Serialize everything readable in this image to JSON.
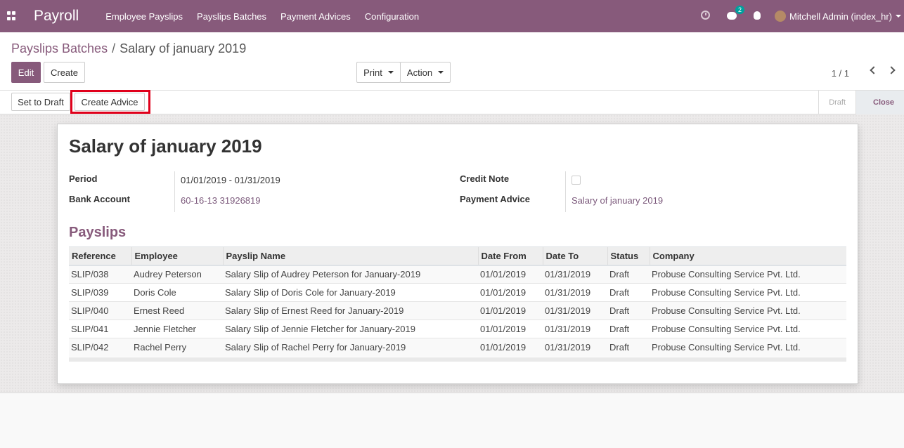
{
  "app": {
    "title": "Payroll"
  },
  "nav": {
    "menu": [
      "Employee Payslips",
      "Payslips Batches",
      "Payment Advices",
      "Configuration"
    ],
    "message_count": "2",
    "user_name": "Mitchell Admin (index_hr)"
  },
  "breadcrumb": {
    "parent": "Payslips Batches",
    "separator": "/",
    "current": "Salary of january 2019"
  },
  "buttons": {
    "edit": "Edit",
    "create": "Create",
    "print": "Print",
    "action": "Action",
    "set_to_draft": "Set to Draft",
    "create_advice": "Create Advice"
  },
  "pager": {
    "text": "1 / 1"
  },
  "status_stages": [
    "Draft",
    "Close"
  ],
  "record": {
    "title": "Salary of january 2019",
    "fields": {
      "period_label": "Period",
      "period_value": "01/01/2019 - 01/31/2019",
      "bank_label": "Bank Account",
      "bank_value": "60-16-13 31926819",
      "credit_label": "Credit Note",
      "credit_checked": false,
      "advice_label": "Payment Advice",
      "advice_value": "Salary of january 2019"
    }
  },
  "payslips": {
    "title": "Payslips",
    "columns": [
      "Reference",
      "Employee",
      "Payslip Name",
      "Date From",
      "Date To",
      "Status",
      "Company"
    ],
    "rows": [
      [
        "SLIP/038",
        "Audrey Peterson",
        "Salary Slip of Audrey Peterson for January-2019",
        "01/01/2019",
        "01/31/2019",
        "Draft",
        "Probuse Consulting Service Pvt. Ltd."
      ],
      [
        "SLIP/039",
        "Doris Cole",
        "Salary Slip of Doris Cole for January-2019",
        "01/01/2019",
        "01/31/2019",
        "Draft",
        "Probuse Consulting Service Pvt. Ltd."
      ],
      [
        "SLIP/040",
        "Ernest Reed",
        "Salary Slip of Ernest Reed for January-2019",
        "01/01/2019",
        "01/31/2019",
        "Draft",
        "Probuse Consulting Service Pvt. Ltd."
      ],
      [
        "SLIP/041",
        "Jennie Fletcher",
        "Salary Slip of Jennie Fletcher for January-2019",
        "01/01/2019",
        "01/31/2019",
        "Draft",
        "Probuse Consulting Service Pvt. Ltd."
      ],
      [
        "SLIP/042",
        "Rachel Perry",
        "Salary Slip of Rachel Perry for January-2019",
        "01/01/2019",
        "01/31/2019",
        "Draft",
        "Probuse Consulting Service Pvt. Ltd."
      ]
    ]
  },
  "colors": {
    "brand": "#875a7b",
    "highlight": "#e0001b",
    "badge": "#00a09d"
  }
}
